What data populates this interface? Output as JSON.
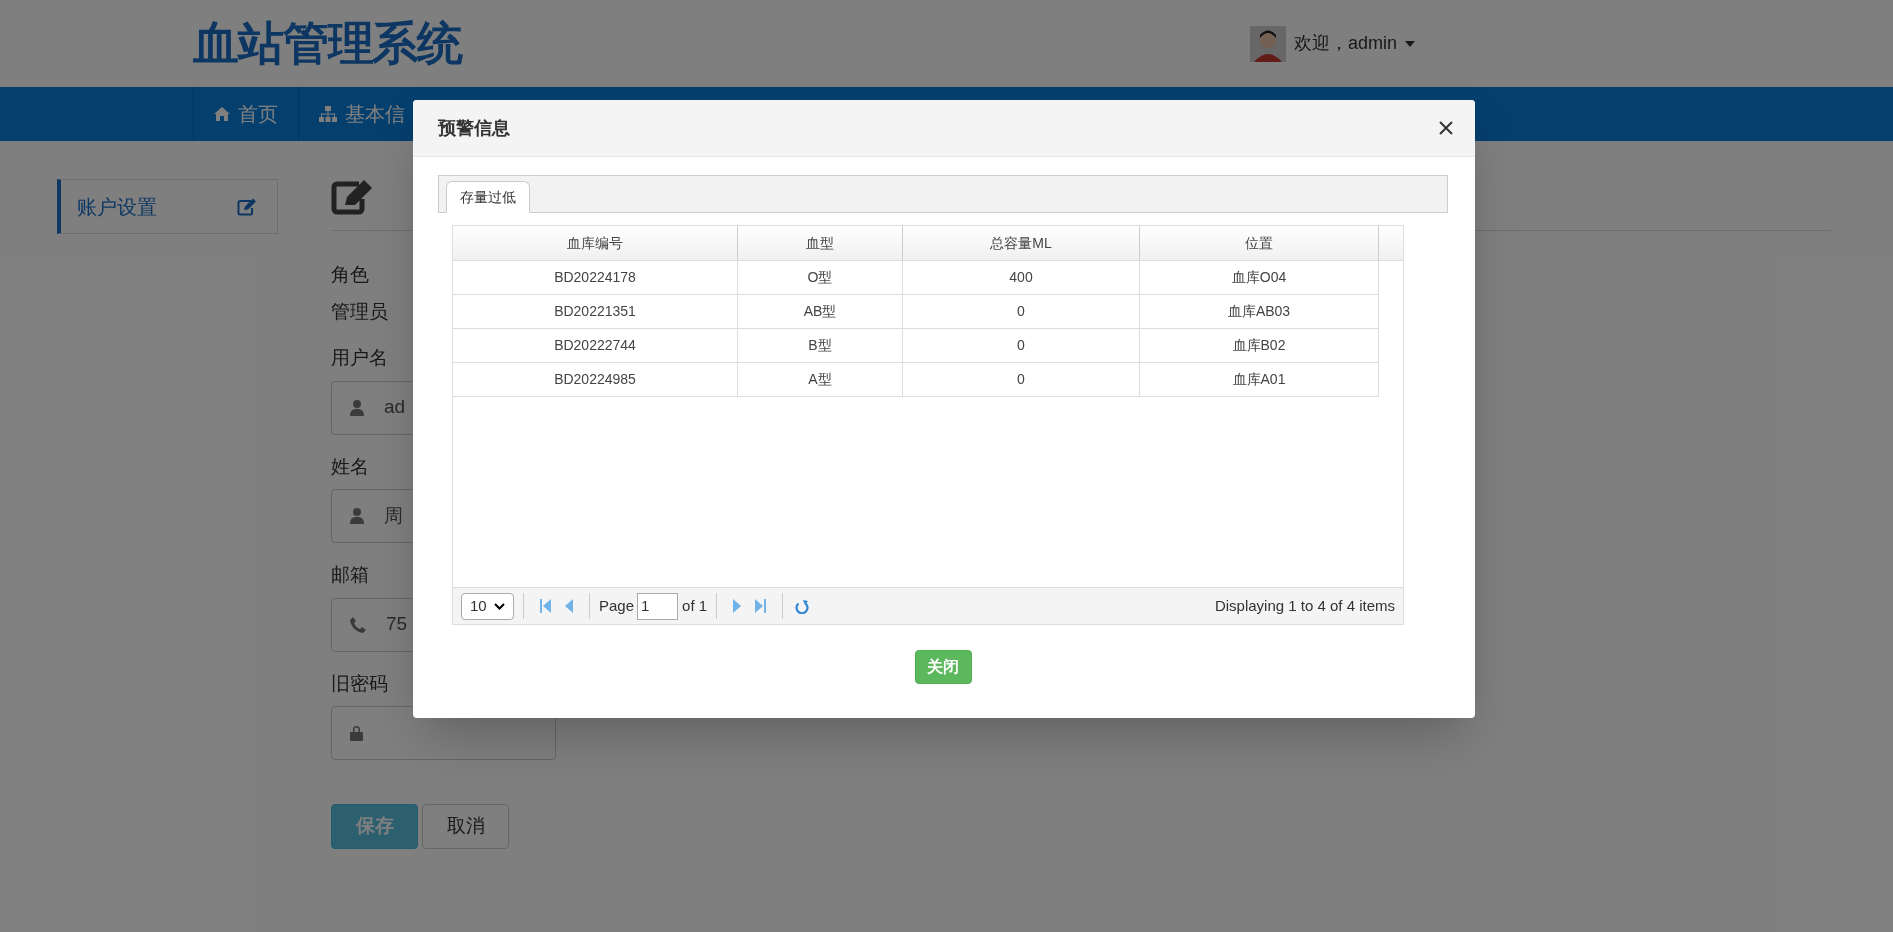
{
  "header": {
    "title": "血站管理系统",
    "user_greeting": "欢迎，admin"
  },
  "nav": [
    {
      "label": "首页"
    },
    {
      "label": "基本信"
    }
  ],
  "sidebar": {
    "items": [
      {
        "label": "账户设置",
        "selected": true
      }
    ]
  },
  "form": {
    "role_label": "角色",
    "role_value": "管理员",
    "fields": [
      {
        "label": "用户名",
        "value": "ad"
      },
      {
        "label": "姓名",
        "value": "周"
      },
      {
        "label": "邮箱",
        "value": "75"
      },
      {
        "label": "旧密码"
      }
    ],
    "buttons": [
      {
        "label": "保存",
        "kind": "primary"
      },
      {
        "label": "取消",
        "kind": "default"
      }
    ]
  },
  "dialog": {
    "title": "预警信息",
    "tabs": [
      {
        "label": "存量过低",
        "selected": true
      }
    ],
    "table": {
      "columns": [
        "血库编号",
        "血型",
        "总容量ML",
        "位置"
      ],
      "rows": [
        [
          "BD20224178",
          "O型",
          "400",
          "血库O04"
        ],
        [
          "BD20221351",
          "AB型",
          "0",
          "血库AB03"
        ],
        [
          "BD20222744",
          "B型",
          "0",
          "血库B02"
        ],
        [
          "BD20224985",
          "A型",
          "0",
          "血库A01"
        ]
      ]
    },
    "pager": {
      "page_size": "10",
      "page_label": "Page",
      "page": "1",
      "page_count": "of 1",
      "summary": "Displaying 1 to 4 of 4 items"
    },
    "close_button": "关闭"
  }
}
